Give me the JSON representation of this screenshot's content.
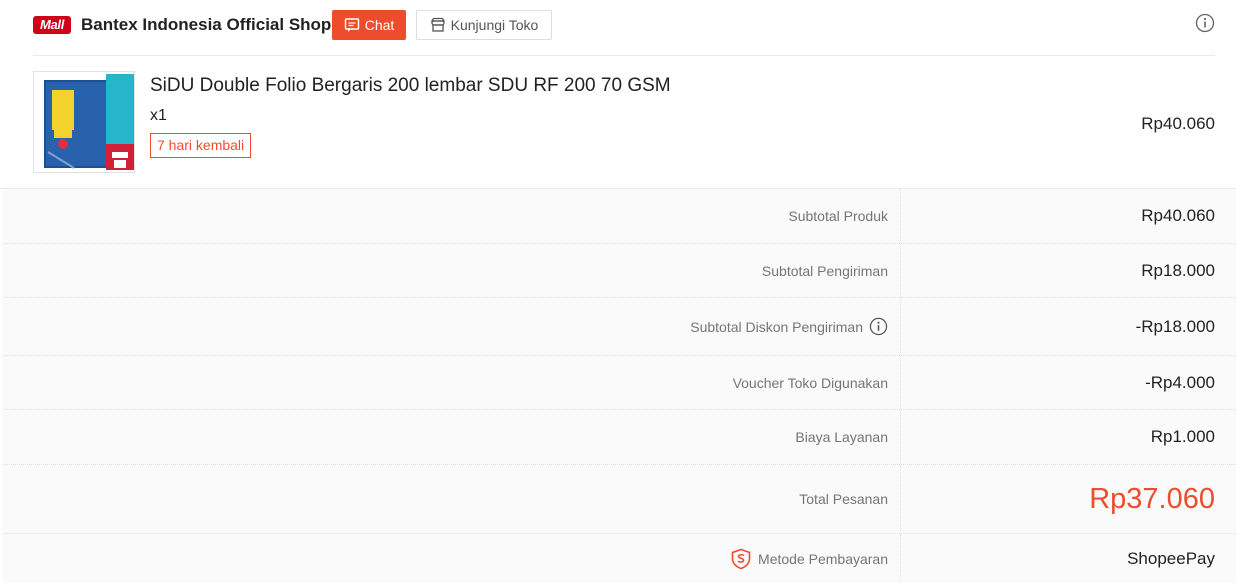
{
  "shop": {
    "badge": "Mall",
    "name": "Bantex Indonesia Official Shop",
    "chat_label": "Chat",
    "visit_label": "Kunjungi Toko"
  },
  "product": {
    "title": "SiDU Double Folio Bergaris 200 lembar SDU RF 200 70 GSM",
    "quantity": "x1",
    "return_badge": "7 hari kembali",
    "price": "Rp40.060"
  },
  "summary": {
    "rows": [
      {
        "label": "Subtotal Produk",
        "value": "Rp40.060"
      },
      {
        "label": "Subtotal Pengiriman",
        "value": "Rp18.000"
      },
      {
        "label": "Subtotal Diskon Pengiriman",
        "value": "-Rp18.000"
      },
      {
        "label": "Voucher Toko Digunakan",
        "value": "-Rp4.000"
      },
      {
        "label": "Biaya Layanan",
        "value": "Rp1.000"
      },
      {
        "label": "Total Pesanan",
        "value": "Rp37.060"
      },
      {
        "label": "Metode Pembayaran",
        "value": "ShopeePay"
      }
    ]
  },
  "colors": {
    "accent": "#ee4d2d",
    "mall": "#d0011b"
  },
  "icons": {
    "chat": "chat-icon",
    "shop": "shop-icon",
    "info": "info-icon",
    "shield": "shopee-guarantee-icon"
  }
}
